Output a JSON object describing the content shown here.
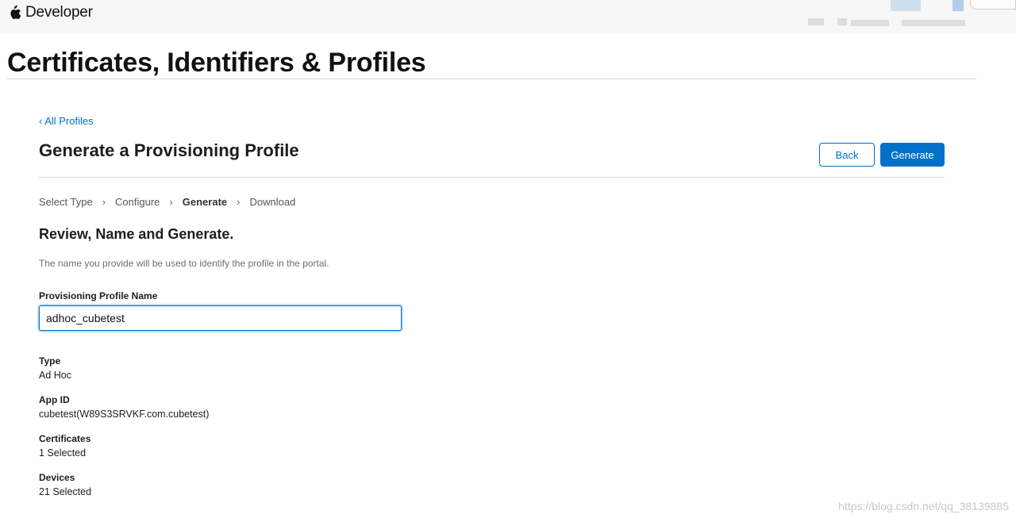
{
  "header": {
    "brand": "Developer"
  },
  "page": {
    "heading": "Certificates, Identifiers & Profiles"
  },
  "nav": {
    "back_link": "‹ All Profiles"
  },
  "section": {
    "title": "Generate a Provisioning Profile",
    "back_button": "Back",
    "generate_button": "Generate"
  },
  "steps": [
    {
      "label": "Select Type",
      "current": false
    },
    {
      "label": "Configure",
      "current": false
    },
    {
      "label": "Generate",
      "current": true
    },
    {
      "label": "Download",
      "current": false
    }
  ],
  "step_separator": "›",
  "form": {
    "subtitle": "Review, Name and Generate.",
    "helper": "The name you provide will be used to identify the profile in the portal.",
    "name_label": "Provisioning Profile Name",
    "name_value": "adhoc_cubetest"
  },
  "details": {
    "type": {
      "label": "Type",
      "value": "Ad Hoc"
    },
    "app_id": {
      "label": "App ID",
      "value": "cubetest(W89S3SRVKF.com.cubetest)"
    },
    "certificates": {
      "label": "Certificates",
      "value": "1 Selected"
    },
    "devices": {
      "label": "Devices",
      "value": "21 Selected"
    }
  },
  "watermark": "https://blog.csdn.net/qq_38139885",
  "colors": {
    "accent": "#0070c9",
    "topbar": "#f7f7f7",
    "rule": "#d6d6d6"
  },
  "icons": {
    "brand": "apple-logo-icon"
  }
}
